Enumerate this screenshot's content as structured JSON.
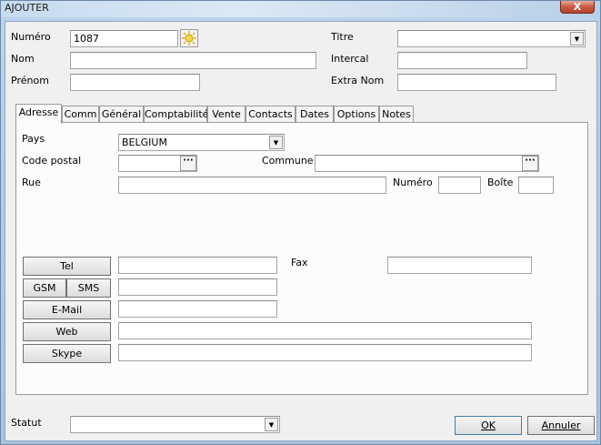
{
  "window": {
    "title": "AJOUTER",
    "close_label": "X"
  },
  "header": {
    "numero_label": "Numéro",
    "numero_value": "1087",
    "nom_label": "Nom",
    "prenom_label": "Prénom",
    "titre_label": "Titre",
    "intercal_label": "Intercal",
    "extra_nom_label": "Extra Nom",
    "dropdown_arrow": "▼"
  },
  "tabs": [
    {
      "label": "Adresse"
    },
    {
      "label": "Comm"
    },
    {
      "label": "Général"
    },
    {
      "label": "Comptabilité"
    },
    {
      "label": "Vente"
    },
    {
      "label": "Contacts"
    },
    {
      "label": "Dates"
    },
    {
      "label": "Options"
    },
    {
      "label": "Notes"
    }
  ],
  "adresse": {
    "pays_label": "Pays",
    "pays_value": "BELGIUM",
    "code_postal_label": "Code postal",
    "commune_label": "Commune",
    "rue_label": "Rue",
    "numero_label": "Numéro",
    "boite_label": "Boîte",
    "dots": "···"
  },
  "contact": {
    "tel_label": "Tel",
    "fax_label": "Fax",
    "gsm_label": "GSM",
    "sms_label": "SMS",
    "email_label": "E-Mail",
    "web_label": "Web",
    "skype_label": "Skype"
  },
  "footer": {
    "statut_label": "Statut",
    "ok_label": "OK",
    "annuler_label": "Annuler"
  },
  "colors": {
    "window_frame": "#a9c3df",
    "client_bg": "#f0f0f0",
    "close_button": "#c85a44"
  }
}
